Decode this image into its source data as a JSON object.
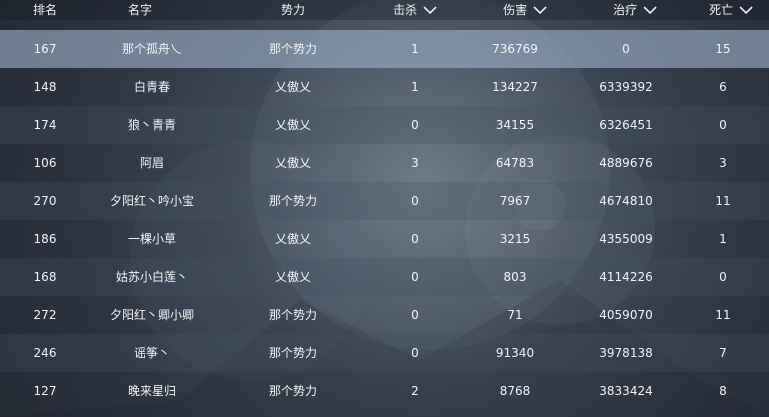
{
  "headers": {
    "rank": "排名",
    "name": "名字",
    "faction": "势力",
    "kills": "击杀",
    "damage": "伤害",
    "heal": "治疗",
    "deaths": "死亡"
  },
  "rows": [
    {
      "rank": "167",
      "name": "那个孤舟乀",
      "faction": "那个势力",
      "kills": "1",
      "damage": "736769",
      "heal": "0",
      "deaths": "15"
    },
    {
      "rank": "148",
      "name": "白青春",
      "faction": "乂傲乂",
      "kills": "1",
      "damage": "134227",
      "heal": "6339392",
      "deaths": "6"
    },
    {
      "rank": "174",
      "name": "狼丶青青",
      "faction": "乂傲乂",
      "kills": "0",
      "damage": "34155",
      "heal": "6326451",
      "deaths": "0"
    },
    {
      "rank": "106",
      "name": "阿眉",
      "faction": "乂傲乂",
      "kills": "3",
      "damage": "64783",
      "heal": "4889676",
      "deaths": "3"
    },
    {
      "rank": "270",
      "name": "夕阳红丶吟小宝",
      "faction": "那个势力",
      "kills": "0",
      "damage": "7967",
      "heal": "4674810",
      "deaths": "11"
    },
    {
      "rank": "186",
      "name": "一棵小草",
      "faction": "乂傲乂",
      "kills": "0",
      "damage": "3215",
      "heal": "4355009",
      "deaths": "1"
    },
    {
      "rank": "168",
      "name": "姑苏小白莲丶",
      "faction": "乂傲乂",
      "kills": "0",
      "damage": "803",
      "heal": "4114226",
      "deaths": "0"
    },
    {
      "rank": "272",
      "name": "夕阳红丶卿小卿",
      "faction": "那个势力",
      "kills": "0",
      "damage": "71",
      "heal": "4059070",
      "deaths": "11"
    },
    {
      "rank": "246",
      "name": "谣筝丶",
      "faction": "那个势力",
      "kills": "0",
      "damage": "91340",
      "heal": "3978138",
      "deaths": "7"
    },
    {
      "rank": "127",
      "name": "晚来星归",
      "faction": "那个势力",
      "kills": "2",
      "damage": "8768",
      "heal": "3833424",
      "deaths": "8"
    }
  ],
  "selected_row_index": 0,
  "sort_icon": "chevron-down-icon",
  "colors": {
    "selected_row": "#9cb0c8",
    "text": "#ffffff"
  }
}
